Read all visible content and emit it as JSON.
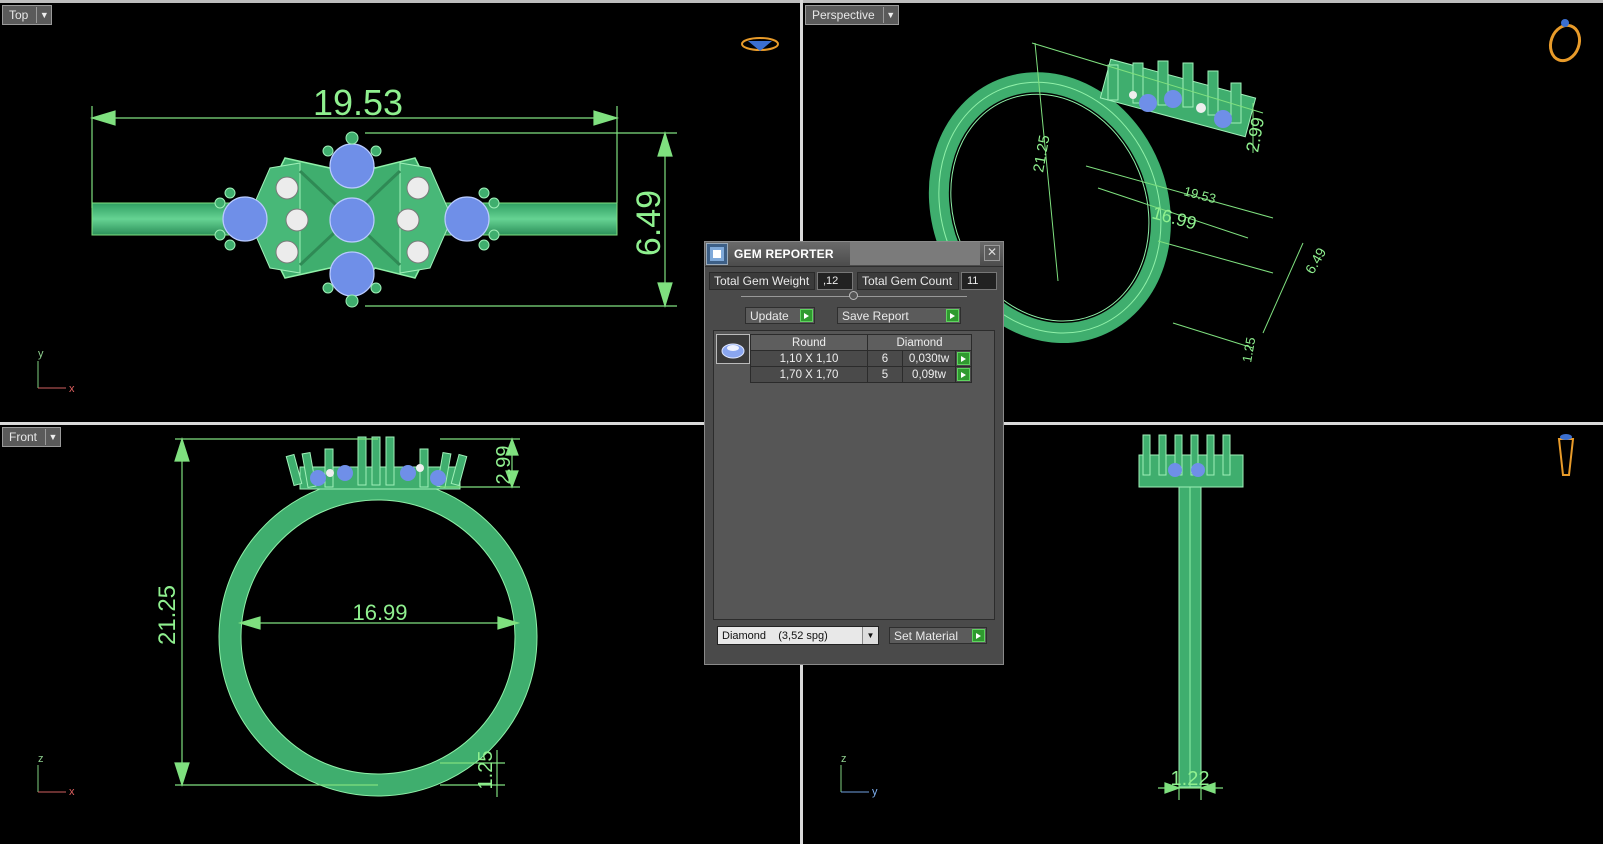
{
  "viewports": {
    "top": {
      "label": "Top",
      "dims": [
        "19.53",
        "6.49"
      ],
      "axes": [
        "y",
        "x"
      ]
    },
    "perspective": {
      "label": "Perspective",
      "dims": [
        "21.25",
        "19.53",
        "16.99",
        "2.99",
        "6.49",
        "1.25"
      ]
    },
    "front": {
      "label": "Front",
      "dims": [
        "21.25",
        "16.99",
        "2.99",
        "1.25"
      ],
      "axes": [
        "z",
        "x"
      ]
    },
    "right": {
      "dims": [
        "1.22"
      ],
      "axes": [
        "z",
        "y"
      ]
    }
  },
  "gem_reporter": {
    "title": "GEM REPORTER",
    "total_weight_label": "Total Gem Weight",
    "total_weight_value": ",12",
    "total_count_label": "Total Gem Count",
    "total_count_value": "11",
    "update_label": "Update",
    "save_report_label": "Save Report",
    "table": {
      "headers": [
        "Round",
        "Diamond"
      ],
      "rows": [
        {
          "size": "1,10 X 1,10",
          "count": "6",
          "weight": "0,030tw"
        },
        {
          "size": "1,70 X 1,70",
          "count": "5",
          "weight": "0,09tw"
        }
      ]
    },
    "material_select": "Diamond    (3,52 spg)",
    "set_material_label": "Set Material"
  },
  "colors": {
    "model": "#3fbf7a",
    "dimension": "#7fe07f",
    "gem": "#6f8fe8",
    "panel": "#4a4a4a"
  }
}
